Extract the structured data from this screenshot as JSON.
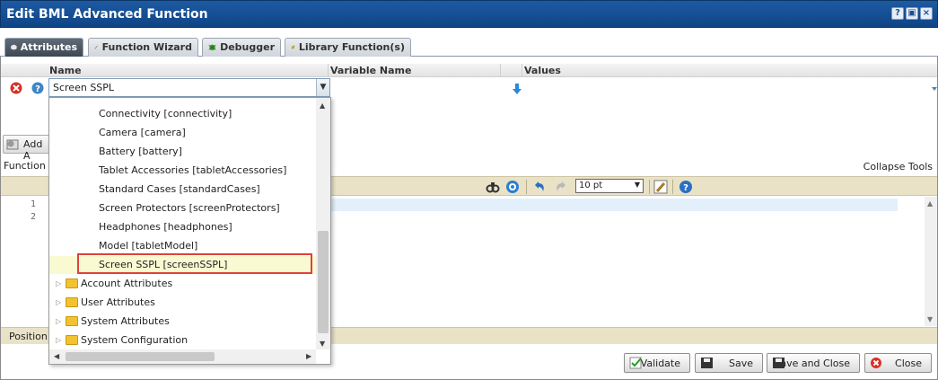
{
  "window": {
    "title": "Edit BML Advanced Function",
    "help_btn": "?",
    "restore_btn": "▣",
    "close_btn": "×"
  },
  "tabs": [
    {
      "label": "Attributes",
      "active": true
    },
    {
      "label": "Function Wizard",
      "active": false
    },
    {
      "label": "Debugger",
      "active": false
    },
    {
      "label": "Library Function(s)",
      "active": false
    }
  ],
  "table": {
    "headers": {
      "name": "Name",
      "variable": "Variable Name",
      "values": "Values"
    },
    "name_value": "Screen SSPL"
  },
  "add_button": "Add A",
  "function_section": "Function s",
  "collapse_tools": "Collapse Tools",
  "toolbar": {
    "font_size": "10 pt"
  },
  "editor": {
    "line_numbers": [
      "1",
      "2"
    ]
  },
  "position_label": "Position:",
  "dropdown": {
    "items": [
      "Connectivity [connectivity]",
      "Camera [camera]",
      "Battery [battery]",
      "Tablet Accessories [tabletAccessories]",
      "Standard Cases [standardCases]",
      "Screen Protectors [screenProtectors]",
      "Headphones [headphones]",
      "Model [tabletModel]",
      "Screen SSPL [screenSSPL]"
    ],
    "folders": [
      "Account Attributes",
      "User Attributes",
      "System Attributes",
      "System Configuration"
    ]
  },
  "footer": {
    "validate": "Validate",
    "save": "Save",
    "save_close": "Save and Close",
    "close": "Close"
  },
  "colors": {
    "title_bar": "#1d5aa3",
    "selected_item_bg": "#fafad2",
    "selection_outline": "#e0403c",
    "toolbar_bg": "#e9e2c7"
  }
}
